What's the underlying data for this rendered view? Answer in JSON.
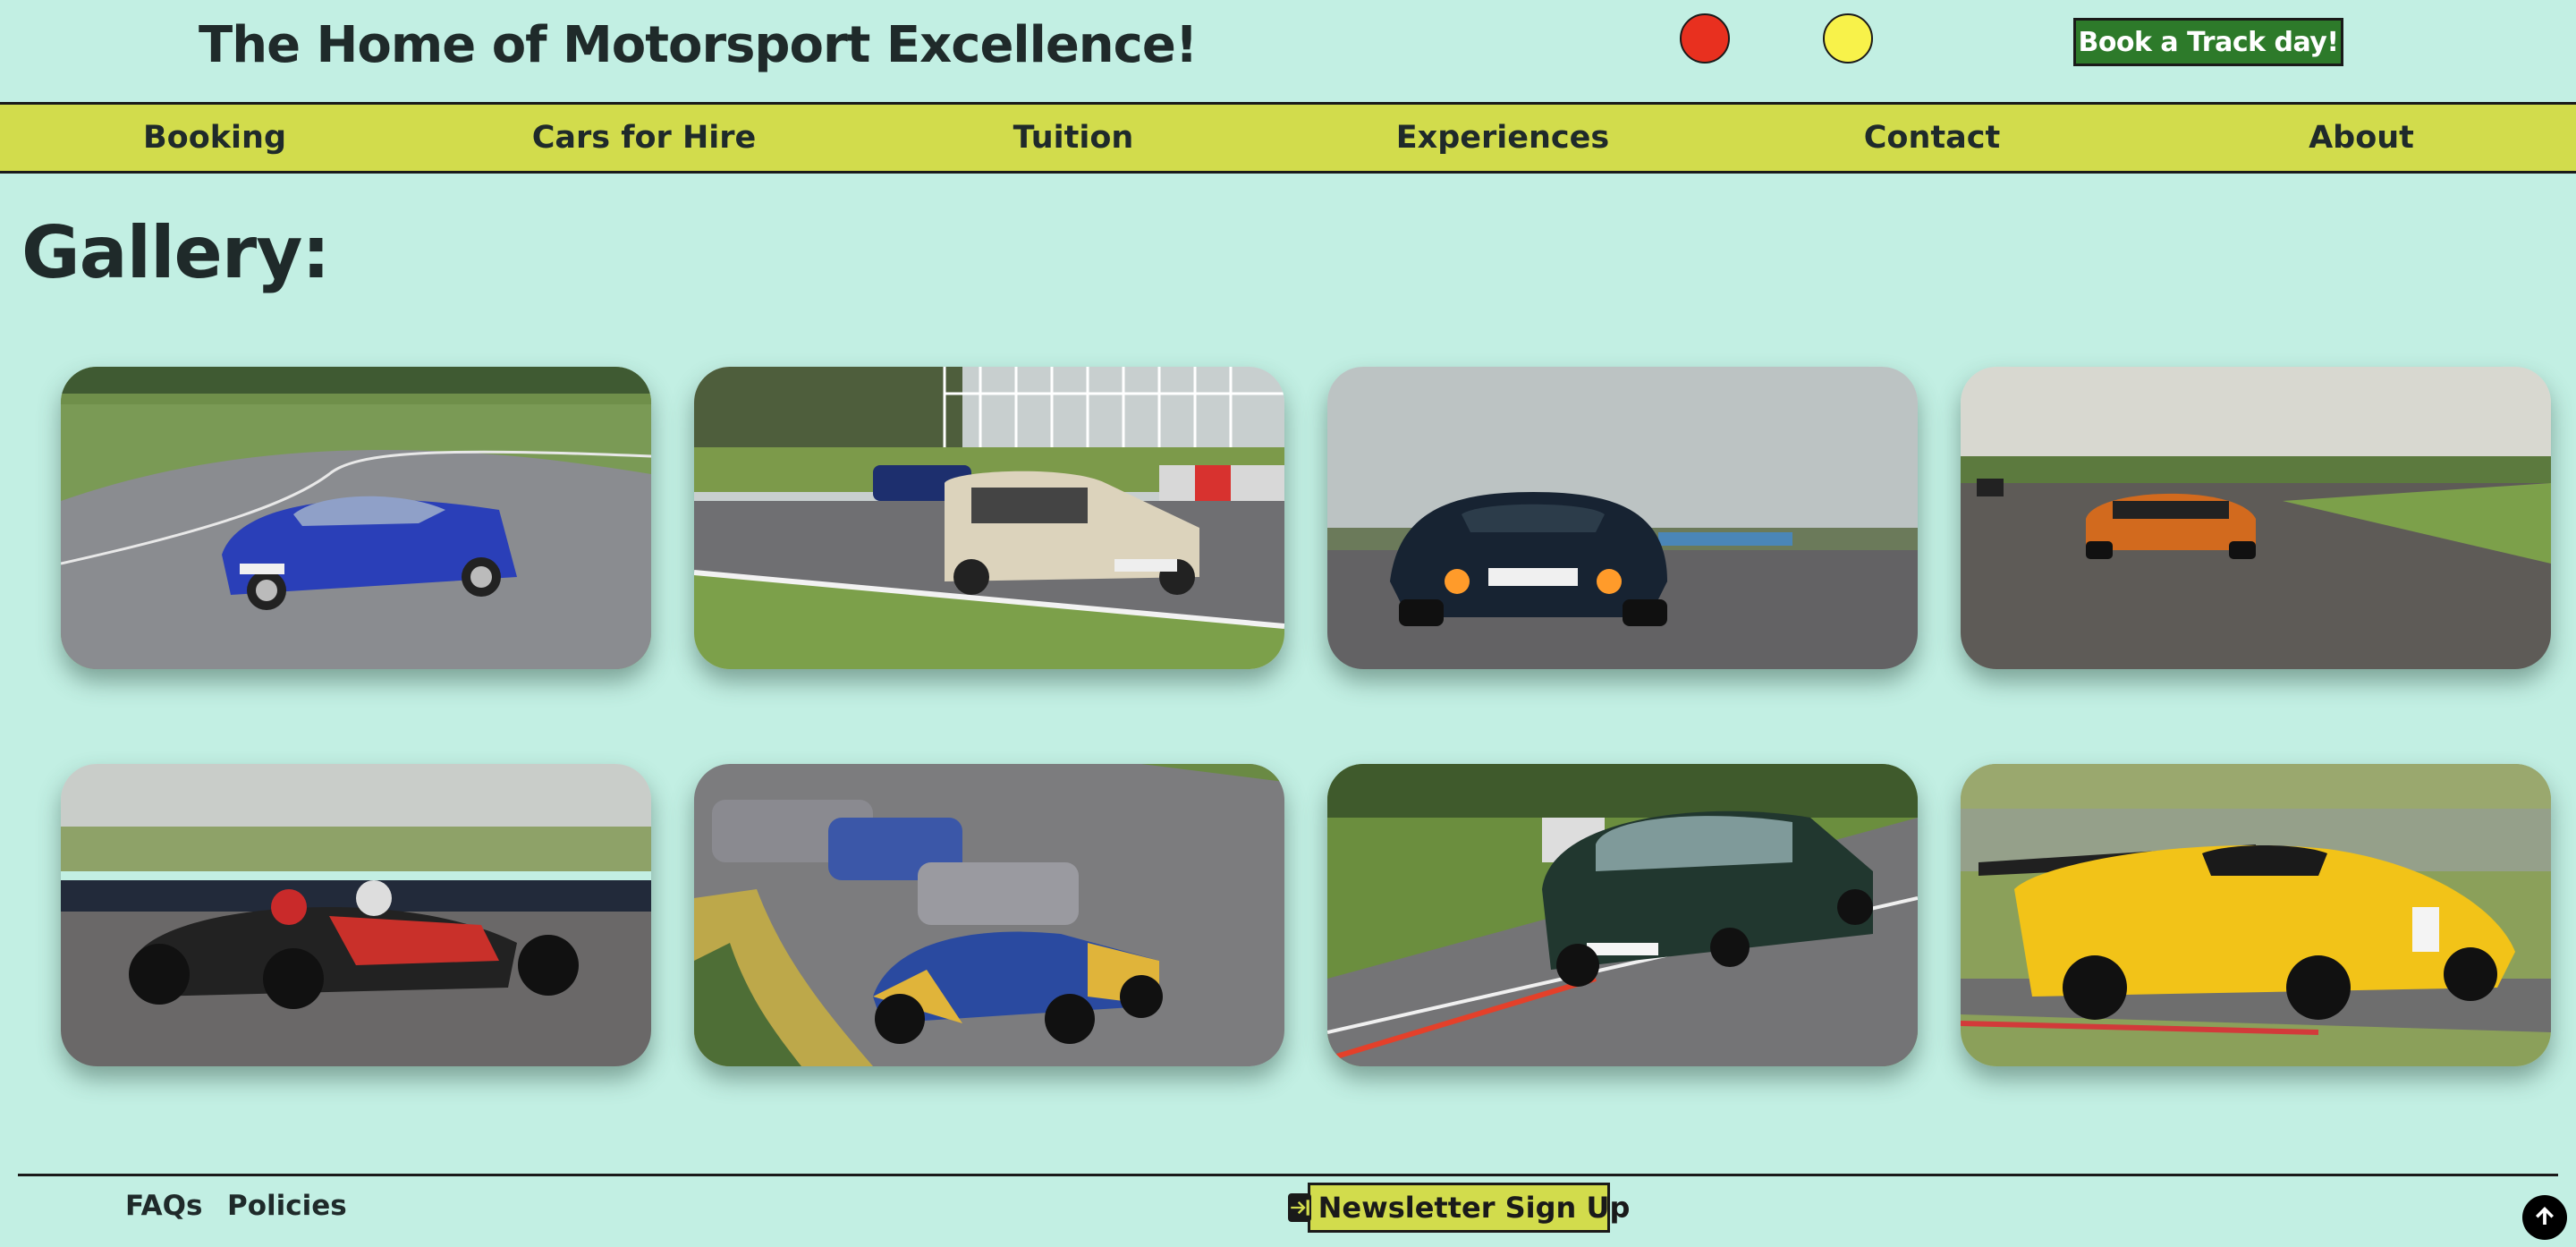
{
  "header": {
    "title": "The Home of Motorsport Excellence!",
    "theme_dots": [
      {
        "name": "red-theme-dot",
        "color": "#e8301f"
      },
      {
        "name": "yellow-theme-dot",
        "color": "#f8f24a"
      }
    ],
    "cta_label": "Book a Track day!"
  },
  "nav": {
    "items": [
      {
        "label": "Booking"
      },
      {
        "label": "Cars for Hire"
      },
      {
        "label": "Tuition"
      },
      {
        "label": "Experiences"
      },
      {
        "label": "Contact"
      },
      {
        "label": "About"
      }
    ]
  },
  "gallery": {
    "title": "Gallery:",
    "images": [
      {
        "name": "gallery-photo-blue-porsche-911"
      },
      {
        "name": "gallery-photo-classic-mini-beige"
      },
      {
        "name": "gallery-photo-lotus-exige-flames"
      },
      {
        "name": "gallery-photo-orange-mclaren"
      },
      {
        "name": "gallery-photo-ariel-atom"
      },
      {
        "name": "gallery-photo-caterham-seven-pack"
      },
      {
        "name": "gallery-photo-green-mini-cooper"
      },
      {
        "name": "gallery-photo-yellow-ferrari-challenge"
      }
    ]
  },
  "footer": {
    "faqs_label": "FAQs",
    "policies_label": "Policies",
    "newsletter_label": "Newsletter Sign Up",
    "newsletter_icon": "sign-in-icon",
    "back_to_top_icon": "arrow-up-icon"
  },
  "colors": {
    "background": "#c2efe3",
    "nav": "#d2dc4c",
    "cta": "#2d7a2a"
  }
}
